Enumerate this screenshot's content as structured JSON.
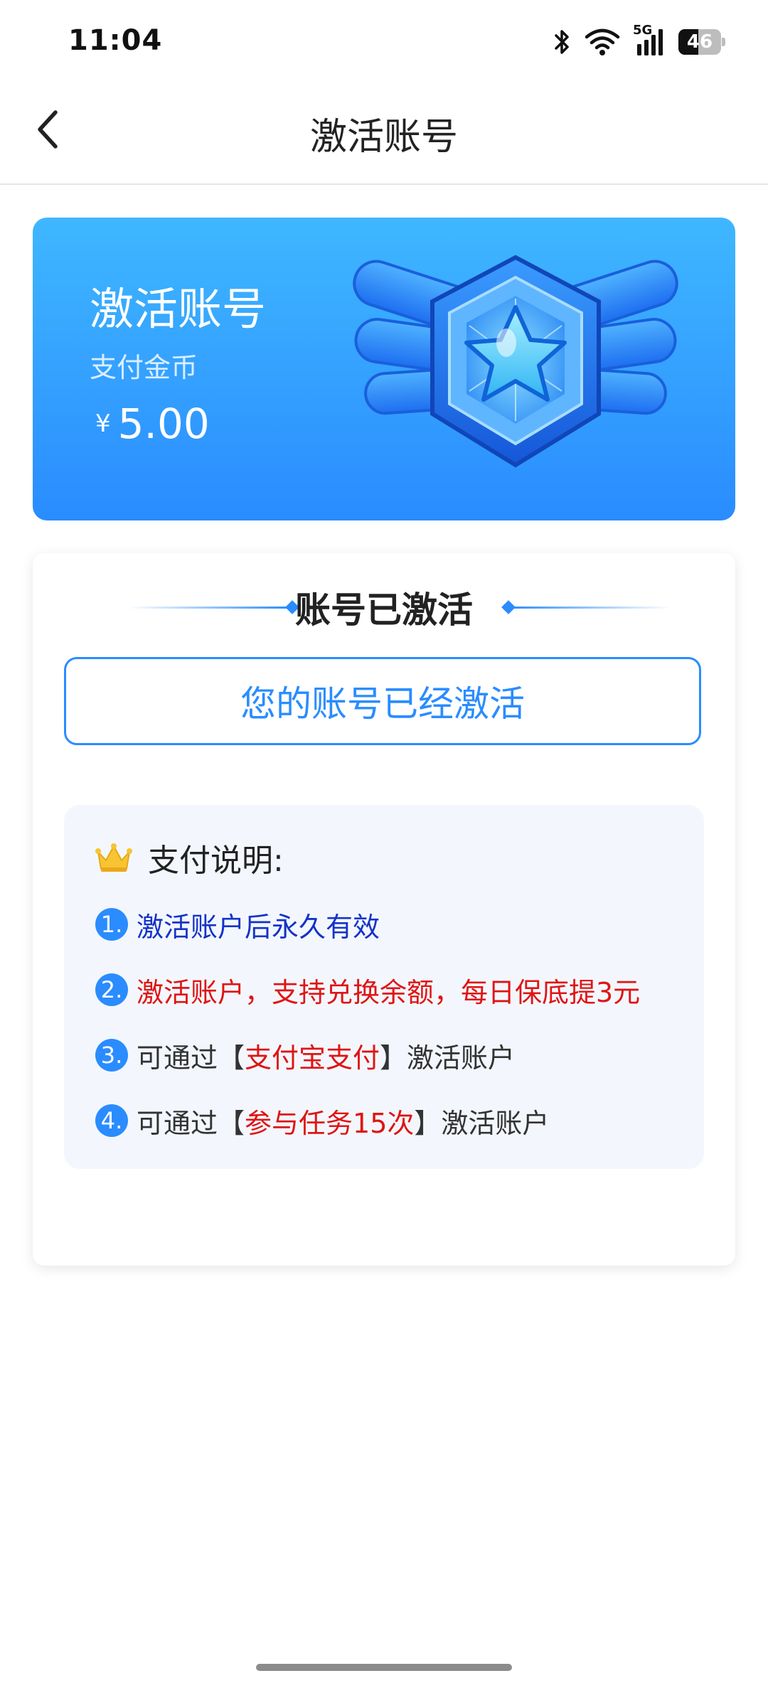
{
  "status_bar": {
    "time": "11:04",
    "network": "5G",
    "battery": "46",
    "battery_level": 0.46,
    "icons": [
      "bluetooth-icon",
      "wifi-icon",
      "cellular-signal-icon",
      "battery-icon"
    ]
  },
  "header": {
    "title": "激活账号",
    "back_icon": "chevron-left-icon"
  },
  "hero": {
    "title": "激活账号",
    "subtitle": "支付金币",
    "currency": "¥",
    "amount": "5.00",
    "badge_icon": "winged-star-badge-icon"
  },
  "status": {
    "heading": "账号已激活",
    "button_label": "您的账号已经激活"
  },
  "notes": {
    "title": "支付说明:",
    "title_icon": "crown-icon",
    "items": [
      {
        "num": "1.",
        "text": "激活账户后永久有效"
      },
      {
        "num": "2.",
        "text": "激活账户，支持兑换余额，每日保底提3元"
      },
      {
        "num": "3.",
        "prefix": "可通过【",
        "highlight": "支付宝支付",
        "suffix": "】激活账户"
      },
      {
        "num": "4.",
        "prefix": "可通过【",
        "highlight": "参与任务15次",
        "suffix": "】激活账户"
      }
    ]
  },
  "colors": {
    "accent_blue": "#2a8cff",
    "hero_gradient_top": "#3fb7ff",
    "hero_gradient_bottom": "#2a8cff",
    "note_blue_text": "#1433c8",
    "note_red_text": "#e01414",
    "notes_background": "#f3f7fd"
  }
}
